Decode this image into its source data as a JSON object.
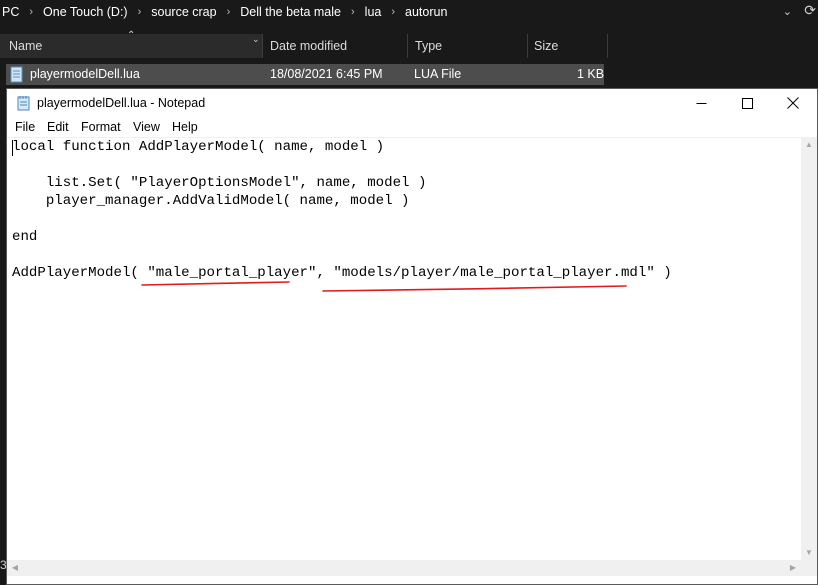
{
  "explorer": {
    "breadcrumb": [
      "PC",
      "One Touch (D:)",
      "source crap",
      "Dell the beta male",
      "lua",
      "autorun"
    ],
    "columns": {
      "name": "Name",
      "date_modified": "Date modified",
      "type": "Type",
      "size": "Size"
    },
    "file": {
      "name": "playermodelDell.lua",
      "date_modified": "18/08/2021 6:45 PM",
      "type": "LUA File",
      "size": "1 KB"
    },
    "left_edge_char": "3"
  },
  "notepad": {
    "title": "playermodelDell.lua - Notepad",
    "menu": [
      "File",
      "Edit",
      "Format",
      "View",
      "Help"
    ],
    "lines": [
      "local function AddPlayerModel( name, model )",
      "",
      "    list.Set( \"PlayerOptionsModel\", name, model )",
      "    player_manager.AddValidModel( name, model )",
      "",
      "end",
      "",
      "AddPlayerModel( \"male_portal_player\", \"models/player/male_portal_player.mdl\" )"
    ],
    "annotation_color": "#e11b1b"
  },
  "icons": {
    "minimize": "minimize-icon",
    "maximize": "maximize-icon",
    "close": "close-icon",
    "file": "notepad-file-icon",
    "refresh": "refresh-icon"
  }
}
